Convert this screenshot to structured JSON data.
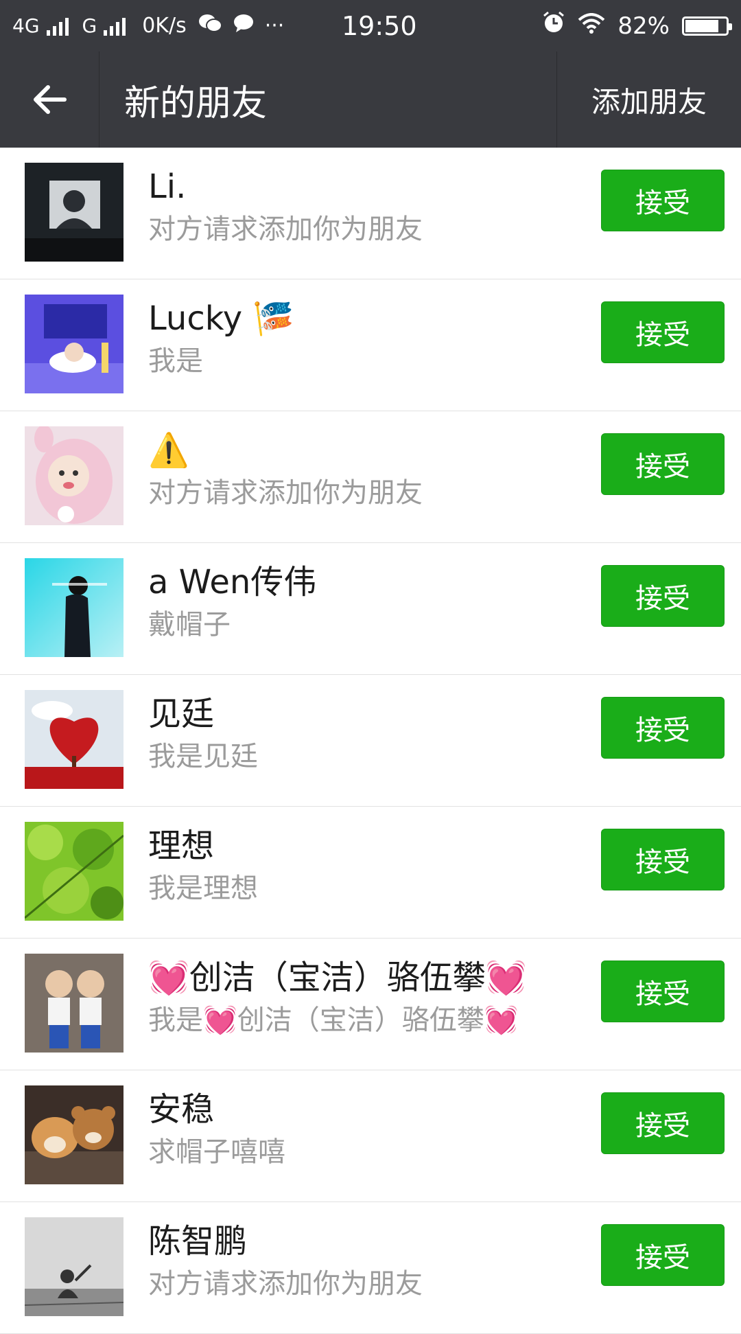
{
  "status_bar": {
    "network_1": "4G",
    "network_2": "G",
    "speed": "0K/s",
    "more": "···",
    "time": "19:50",
    "battery": "82%",
    "battery_level": 0.82
  },
  "header": {
    "title": "新的朋友",
    "add_friend_label": "添加朋友"
  },
  "requests": [
    {
      "name": "Li.",
      "message": "对方请求添加你为朋友",
      "accept_label": "接受",
      "avatar_icon": "avatar-dark-portrait"
    },
    {
      "name": "Lucky 🎏",
      "message": "我是",
      "accept_label": "接受",
      "avatar_icon": "avatar-purple-cartoon"
    },
    {
      "name": "⚠️",
      "message": "对方请求添加你为朋友",
      "accept_label": "接受",
      "avatar_icon": "avatar-pink-child"
    },
    {
      "name": "a   Wen传伟",
      "message": "戴帽子",
      "accept_label": "接受",
      "avatar_icon": "avatar-cyan-silhouette"
    },
    {
      "name": "见廷",
      "message": "我是见廷",
      "accept_label": "接受",
      "avatar_icon": "avatar-heart-tree"
    },
    {
      "name": "理想",
      "message": "我是理想",
      "accept_label": "接受",
      "avatar_icon": "avatar-green-leaves"
    },
    {
      "name": "💓创洁（宝洁）骆伍攀💓",
      "message": "我是💓创洁（宝洁）骆伍攀💓",
      "accept_label": "接受",
      "avatar_icon": "avatar-twin-kids"
    },
    {
      "name": "安稳",
      "message": "求帽子嘻嘻",
      "accept_label": "接受",
      "avatar_icon": "avatar-dog-bear"
    },
    {
      "name": "陈智鹏",
      "message": "对方请求添加你为朋友",
      "accept_label": "接受",
      "avatar_icon": "avatar-grey-landscape"
    }
  ],
  "colors": {
    "header_bg": "#393a3f",
    "accept_green": "#1aad19",
    "name_text": "#1c1c1c",
    "message_text": "#9b9b9b"
  }
}
